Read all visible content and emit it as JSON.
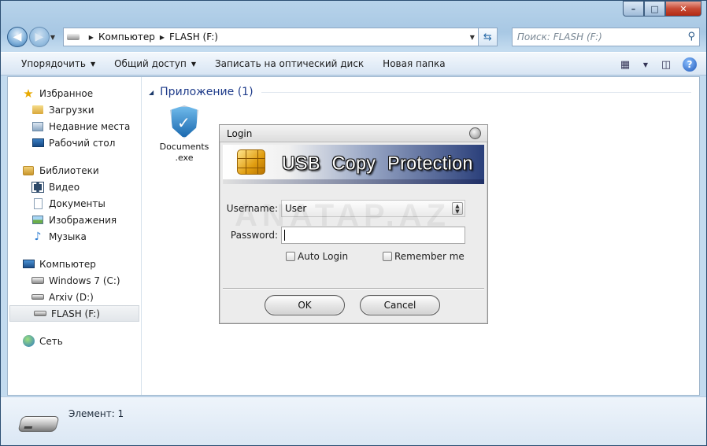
{
  "window": {
    "caption": {
      "minimize": "–",
      "maximize": "□",
      "close": "✕"
    }
  },
  "address_bar": {
    "crumbs": [
      "Компьютер",
      "FLASH (F:)"
    ],
    "search_placeholder": "Поиск: FLASH (F:)"
  },
  "toolbar": {
    "items": [
      {
        "label": "Упорядочить",
        "has_dropdown": true
      },
      {
        "label": "Общий доступ",
        "has_dropdown": true
      },
      {
        "label": "Записать на оптический диск",
        "has_dropdown": false
      },
      {
        "label": "Новая папка",
        "has_dropdown": false
      }
    ]
  },
  "sidebar": {
    "favorites": {
      "label": "Избранное",
      "items": [
        "Загрузки",
        "Недавние места",
        "Рабочий стол"
      ]
    },
    "libraries": {
      "label": "Библиотеки",
      "items": [
        "Видео",
        "Документы",
        "Изображения",
        "Музыка"
      ]
    },
    "computer": {
      "label": "Компьютер",
      "items": [
        "Windows 7 (C:)",
        "Arxiv (D:)",
        "FLASH (F:)"
      ],
      "selected": "FLASH (F:)"
    },
    "network": {
      "label": "Сеть"
    }
  },
  "content": {
    "group_title": "Приложение (1)",
    "file": {
      "name": "Documents\n.exe",
      "icon": "shield-check-icon"
    }
  },
  "status": {
    "text": "Элемент: 1"
  },
  "login_dialog": {
    "title": "Login",
    "banner_title": "USB Copy Protection",
    "username_label": "Username:",
    "username_value": "User",
    "password_label": "Password:",
    "auto_login_label": "Auto Login",
    "remember_me_label": "Remember me",
    "ok_label": "OK",
    "cancel_label": "Cancel"
  },
  "watermark": "ANATAP.AZ"
}
